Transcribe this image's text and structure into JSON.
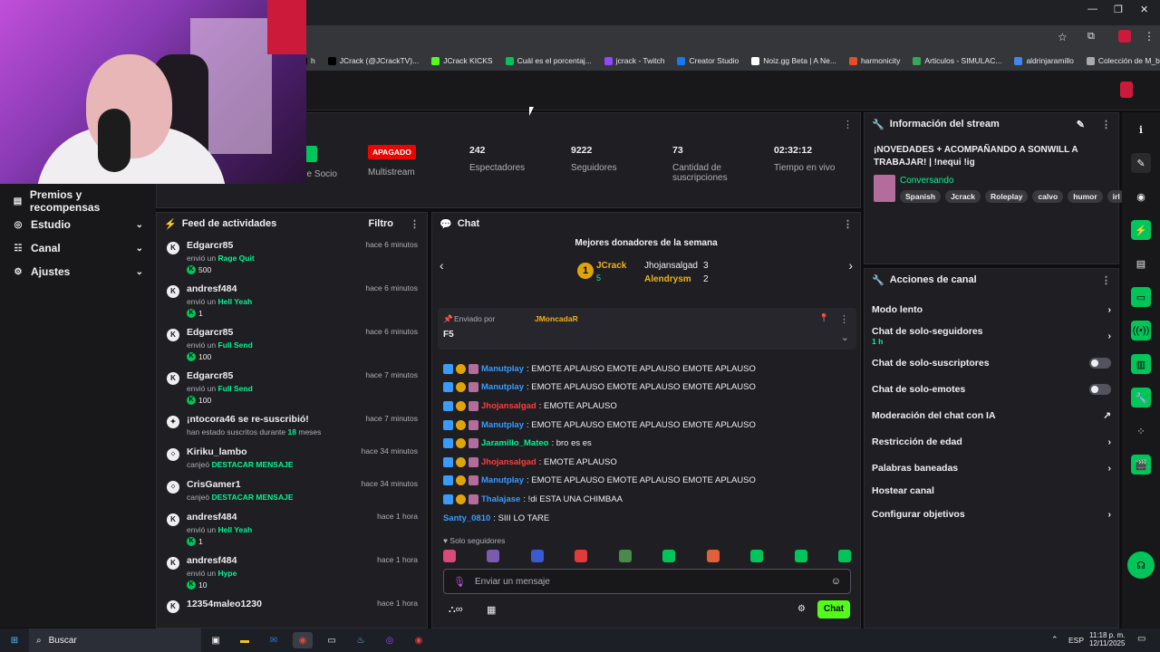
{
  "browser": {
    "bookmarks": [
      {
        "label": "h",
        "color": "#000000"
      },
      {
        "label": "JCrack (@JCrackTV)...",
        "color": "#000000"
      },
      {
        "label": "JCrack KICKS",
        "color": "#53fc18"
      },
      {
        "label": "Cuál es el porcentaj...",
        "color": "#00c55a"
      },
      {
        "label": "jcrack - Twitch",
        "color": "#9146ff"
      },
      {
        "label": "Creator Studio",
        "color": "#1877f2"
      },
      {
        "label": "Noiz.gg Beta | A Ne...",
        "color": "#ffffff"
      },
      {
        "label": "harmonicity",
        "color": "#e44d26"
      },
      {
        "label": "Articulos - SIMULAC...",
        "color": "#34a853"
      },
      {
        "label": "aldrinjaramillo",
        "color": "#4285f4"
      },
      {
        "label": "Colección de M_blei...",
        "color": "#aaaaaa"
      }
    ]
  },
  "nav": {
    "items": [
      {
        "label": "Premios y recompensas",
        "icon": "gift-icon"
      },
      {
        "label": "Estudio",
        "icon": "studio-icon"
      },
      {
        "label": "Canal",
        "icon": "channel-icon"
      },
      {
        "label": "Ajustes",
        "icon": "gear-icon"
      }
    ]
  },
  "stats": {
    "partner_label": "de Socio",
    "multistream_status": "APAGADO",
    "multistream_label": "Multistream",
    "viewers_value": "242",
    "viewers_label": "Espectadores",
    "followers_value": "9222",
    "followers_label": "Seguidores",
    "subs_value": "73",
    "subs_label": "Cantidad de suscripciones",
    "uptime_value": "02:32:12",
    "uptime_label": "Tiempo en vivo"
  },
  "feed": {
    "title": "Feed de actividades",
    "filter": "Filtro",
    "rows": [
      {
        "name": "Edgarcr85",
        "time": "hace 6 minutos",
        "sub": "envió un",
        "item": "Rage Quit",
        "amount": "500"
      },
      {
        "name": "andresf484",
        "time": "hace 6 minutos",
        "sub": "envió un",
        "item": "Hell Yeah",
        "amount": "1"
      },
      {
        "name": "Edgarcr85",
        "time": "hace 6 minutos",
        "sub": "envió un",
        "item": "Full Send",
        "amount": "100"
      },
      {
        "name": "Edgarcr85",
        "time": "hace 7 minutos",
        "sub": "envió un",
        "item": "Full Send",
        "amount": "100"
      },
      {
        "name": "¡ntocora46 se re-suscribió!",
        "time": "hace 7 minutos",
        "sub": "han estado suscritos durante",
        "item": "18",
        "tail": "meses",
        "amount": ""
      },
      {
        "name": "Kiriku_lambo",
        "time": "hace 34 minutos",
        "sub": "canjeó",
        "item": "DESTACAR MENSAJE",
        "amount": ""
      },
      {
        "name": "CrisGamer1",
        "time": "hace 34 minutos",
        "sub": "canjeó",
        "item": "DESTACAR MENSAJE",
        "amount": ""
      },
      {
        "name": "andresf484",
        "time": "hace 1 hora",
        "sub": "envió un",
        "item": "Hell Yeah",
        "amount": "1"
      },
      {
        "name": "andresf484",
        "time": "hace 1 hora",
        "sub": "envió un",
        "item": "Hype",
        "amount": "10"
      },
      {
        "name": "12354maleo1230",
        "time": "hace 1 hora",
        "sub": "",
        "item": "",
        "amount": ""
      }
    ]
  },
  "chat": {
    "title": "Chat",
    "donors_title": "Mejores donadores de la semana",
    "donor1_name": "JCrack",
    "donor1_count": "5",
    "donor2_name": "Jhojansalgad",
    "donor2_count": "3",
    "donor3_name": "Alendrysm",
    "donor3_count": "2",
    "pinned_label": "Enviado por",
    "pinned_user": "JMoncadaR",
    "pinned_msg": "F5",
    "messages": [
      {
        "user": "Manutplay",
        "color": "#3a9bff",
        "text": ": EMOTE APLAUSO EMOTE APLAUSO EMOTE APLAUSO"
      },
      {
        "user": "Manutplay",
        "color": "#3a9bff",
        "text": ": EMOTE APLAUSO EMOTE APLAUSO EMOTE APLAUSO"
      },
      {
        "user": "Jhojansalgad",
        "color": "#ff3c3c",
        "text": ": EMOTE APLAUSO"
      },
      {
        "user": "Manutplay",
        "color": "#3a9bff",
        "text": ": EMOTE APLAUSO EMOTE APLAUSO EMOTE APLAUSO"
      },
      {
        "user": "Jaramillo_Mateo",
        "color": "#00f593",
        "text": ": bro es es"
      },
      {
        "user": "Jhojansalgad",
        "color": "#ff3c3c",
        "text": ": EMOTE APLAUSO"
      },
      {
        "user": "Manutplay",
        "color": "#3a9bff",
        "text": ": EMOTE APLAUSO EMOTE APLAUSO EMOTE APLAUSO"
      },
      {
        "user": "Thalajase",
        "color": "#3a9bff",
        "text": ": !di ESTA UNA CHIMBAA"
      },
      {
        "user": "Santy_0810",
        "color": "#3a9bff",
        "text": ": SIII LO TARE"
      }
    ],
    "followers_only": "Solo seguidores",
    "input_placeholder": "Enviar un mensaje",
    "send_button": "Chat"
  },
  "info": {
    "title": "Información del stream",
    "stream_title": "¡NOVEDADES + ACOMPAÑANDO A SONWILL A TRABAJAR! | !nequi !ig",
    "category": "Conversando",
    "tags": [
      "Spanish",
      "Jcrack",
      "Roleplay",
      "calvo",
      "humor",
      "irl"
    ]
  },
  "acciones": {
    "title": "Acciones de canal",
    "slow": "Modo lento",
    "followers_only": "Chat de solo-seguidores",
    "followers_only_value": "1 h",
    "subs_only": "Chat de solo-suscriptores",
    "emotes_only": "Chat de solo-emotes",
    "ai_mod": "Moderación del chat con IA",
    "age": "Restricción de edad",
    "banned": "Palabras baneadas",
    "host": "Hostear canal",
    "goals": "Configurar objetivos"
  },
  "taskbar": {
    "search": "Buscar",
    "lang": "ESP",
    "time": "11:18 p. m.",
    "date": "12/11/2025"
  }
}
